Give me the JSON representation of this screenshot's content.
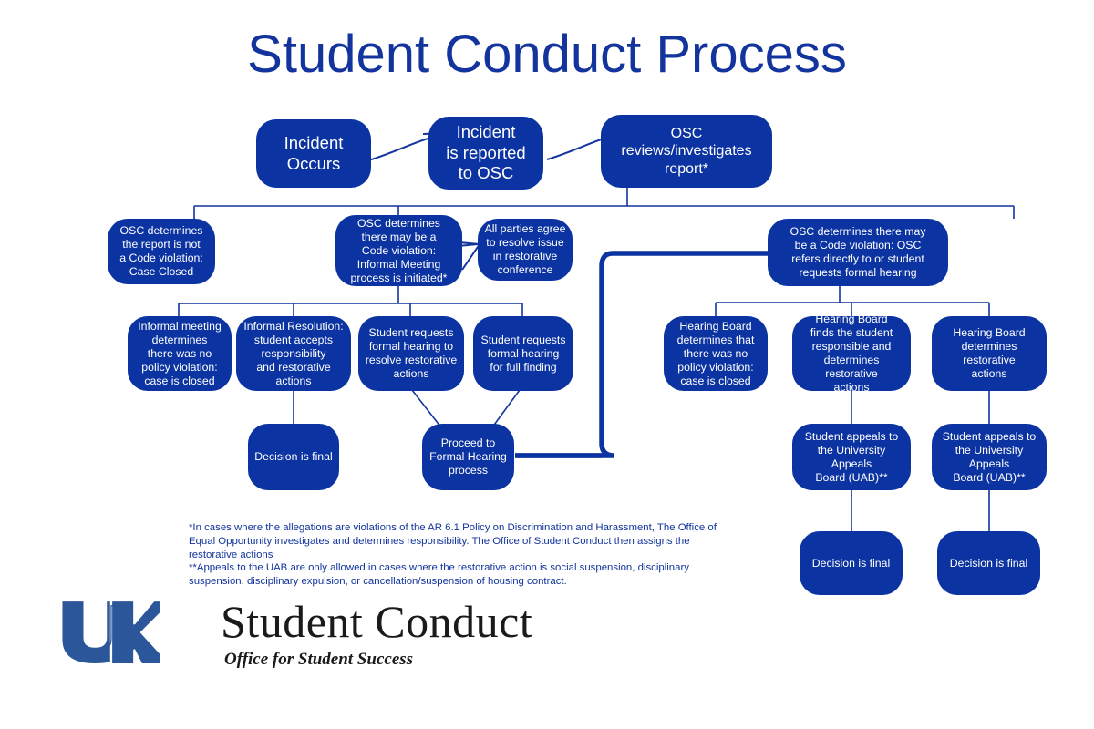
{
  "page": {
    "title": "Student Conduct Process",
    "background_color": "#ffffff",
    "node_fill": "#0B33A1",
    "accent_blue": "#12349C",
    "node_text_color": "#ffffff"
  },
  "nodes": {
    "incident_occurs": "Incident\nOccurs",
    "incident_reported": "Incident\nis reported\nto OSC",
    "osc_reviews": "OSC\nreviews/investigates\nreport*",
    "no_violation_closed": "OSC determines\nthe report is not\na Code violation:\nCase Closed",
    "informal_meeting_initiated": "OSC determines\nthere may be a\nCode violation:\nInformal Meeting\nprocess is initiated*",
    "restorative_conference": "All parties agree\nto resolve issue\nin restorative\nconference",
    "formal_hearing_referral": "OSC determines there may\nbe a Code violation: OSC\nrefers directly to or student\nrequests formal hearing",
    "informal_no_violation": "Informal meeting\ndetermines\nthere was no\npolicy violation:\ncase is closed",
    "informal_resolution": "Informal Resolution:\nstudent accepts\nresponsibility\nand restorative\nactions",
    "requests_hearing_restorative": "Student requests\nformal hearing to\nresolve restorative\nactions",
    "requests_hearing_full": "Student requests\nformal hearing\nfor full finding",
    "decision_final_left": "Decision is final",
    "proceed_formal_hearing": "Proceed to\nFormal Hearing\nprocess",
    "board_no_violation": "Hearing Board\ndetermines that\nthere was no\npolicy violation:\ncase is closed",
    "board_responsible": "Hearing Board\nfinds the student\nresponsible and\ndetermines restorative\nactions",
    "board_restorative": "Hearing Board\ndetermines restorative\nactions",
    "appeals_uab_1": "Student appeals to\nthe University Appeals\nBoard (UAB)**",
    "appeals_uab_2": "Student appeals to\nthe University Appeals\nBoard (UAB)**",
    "decision_final_mid": "Decision is final",
    "decision_final_right": "Decision is final"
  },
  "footnotes": {
    "single_star": "*In cases where the allegations are violations of the AR 6.1 Policy on Discrimination and Harassment, The Office of Equal Opportunity investigates and determines responsibility. The Office of Student Conduct then assigns the restorative actions",
    "double_star": "**Appeals to the UAB are only allowed in cases where the restorative action is social suspension, disciplinary suspension, disciplinary expulsion, or cancellation/suspension of housing contract."
  },
  "brand": {
    "logo_text": "UK",
    "name": "Student Conduct",
    "tagline": "Office for Student Success",
    "logo_color": "#2B5699"
  }
}
